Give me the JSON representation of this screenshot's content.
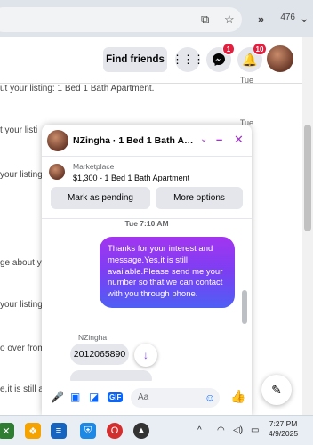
{
  "browser": {
    "tab_count": "476",
    "more_label": "»",
    "colors": {
      "bar": "#dfe3ea"
    }
  },
  "header": {
    "find_friends_label": "Find friends",
    "messenger_badge": "1",
    "notifications_badge": "10"
  },
  "listing_items": [
    {
      "text": "ut your listing: 1 Bed 1 Bath Apartment.",
      "time": "Tue"
    },
    {
      "text": "t your listi",
      "time": "Tue"
    },
    {
      "text": "your listing: 1",
      "time": ""
    },
    {
      "text": "ge about y",
      "time": ""
    },
    {
      "text": "your listing",
      "time": ""
    },
    {
      "text": "o over from",
      "time": ""
    },
    {
      "text": "e,it is still a",
      "time": ""
    }
  ],
  "chat": {
    "title": "NZingha · 1 Bed 1 Bath Ap...",
    "marketplace_label": "Marketplace",
    "listing_price": "$1,300 - 1 Bed 1 Bath Apartment",
    "mark_pending_label": "Mark as pending",
    "more_options_label": "More options",
    "timestamp": "Tue 7:10 AM",
    "outgoing_message": "Thanks for your interest and message.Yes,it is still available.Please send me your number so that we can contact with you through phone.",
    "sender_name": "NZingha",
    "incoming_message": "2012065890",
    "composer_placeholder": "Aa",
    "accent_color": "#a032c8"
  },
  "taskbar": {
    "clock_time": "7:27 PM",
    "clock_date": "4/9/2025"
  },
  "icons": [
    "install-icon",
    "star-icon",
    "messenger-icon",
    "bell-icon",
    "apps-icon",
    "minimize-icon",
    "close-icon",
    "chevron-down-icon",
    "mic-icon",
    "image-icon",
    "sticker-icon",
    "gif-icon",
    "emoji-icon",
    "like-icon",
    "edit-icon",
    "arrow-down-icon",
    "wifi-icon",
    "volume-icon",
    "battery-icon"
  ]
}
